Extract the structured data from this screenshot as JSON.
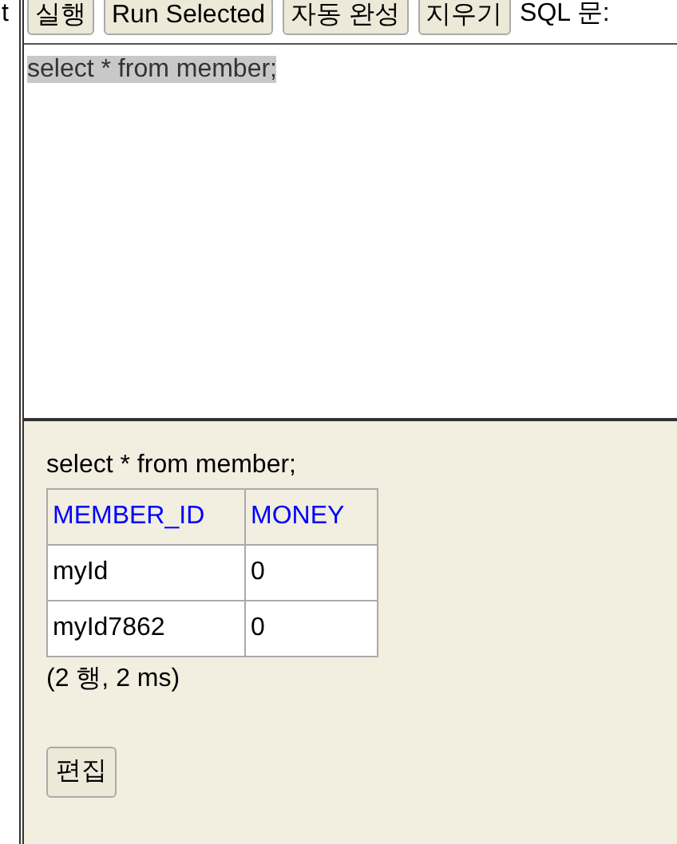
{
  "left_fragment": "t",
  "toolbar": {
    "buttons": [
      "실행",
      "Run Selected",
      "자동 완성",
      "지우기"
    ],
    "label": "SQL 문:"
  },
  "editor": {
    "text": "select * from member;",
    "selected": true
  },
  "result": {
    "query": "select * from member;",
    "table": {
      "columns": [
        "MEMBER_ID",
        "MONEY"
      ],
      "rows": [
        [
          "myId",
          "0"
        ],
        [
          "myId7862",
          "0"
        ]
      ]
    },
    "status": "(2 행, 2 ms)",
    "edit_button": "편집"
  }
}
